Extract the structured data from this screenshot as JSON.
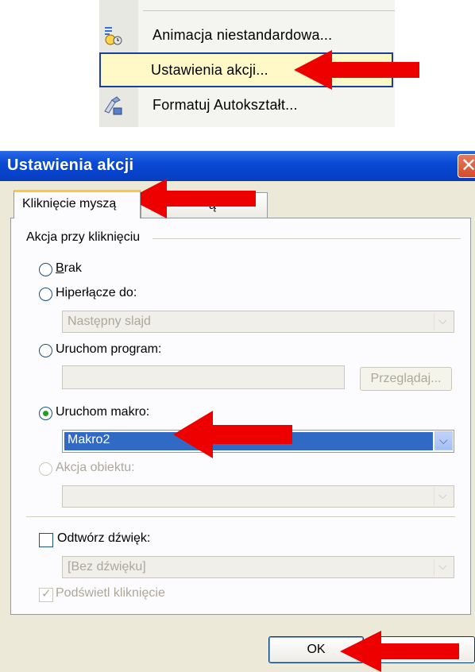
{
  "context_menu": {
    "items": [
      {
        "label": "Animacja niestandardowa...",
        "icon": "custom-animation-icon"
      },
      {
        "label": "Ustawienia akcji...",
        "icon": "none",
        "highlighted": true
      },
      {
        "label": "Formatuj Autokształt...",
        "icon": "format-autoshape-icon"
      }
    ]
  },
  "dialog": {
    "title": "Ustawienia akcji",
    "tabs": [
      {
        "label": "Kliknięcie myszą",
        "active": true
      },
      {
        "label": "ą",
        "active": false
      }
    ],
    "group_label": "Akcja przy kliknięciu",
    "options": {
      "none": {
        "label": "Brak"
      },
      "hyperlink": {
        "label": "Hiperłącze do:",
        "value": "Następny slajd"
      },
      "run_program": {
        "label": "Uruchom program:",
        "value": "",
        "browse_label": "Przeglądaj..."
      },
      "run_macro": {
        "label": "Uruchom makro:",
        "value": "Makro2",
        "checked": true
      },
      "object_action": {
        "label": "Akcja obiektu:",
        "value": ""
      }
    },
    "play_sound": {
      "label": "Odtwórz dźwięk:",
      "value": "[Bez dźwięku]",
      "checked": false
    },
    "highlight_click": {
      "label": "Podświetl kliknięcie",
      "checked": true
    },
    "ok_label": "OK"
  },
  "colors": {
    "annotation_arrow": "#ee0000",
    "title_bar": "#0a4ad3",
    "selection": "#316ac5"
  }
}
